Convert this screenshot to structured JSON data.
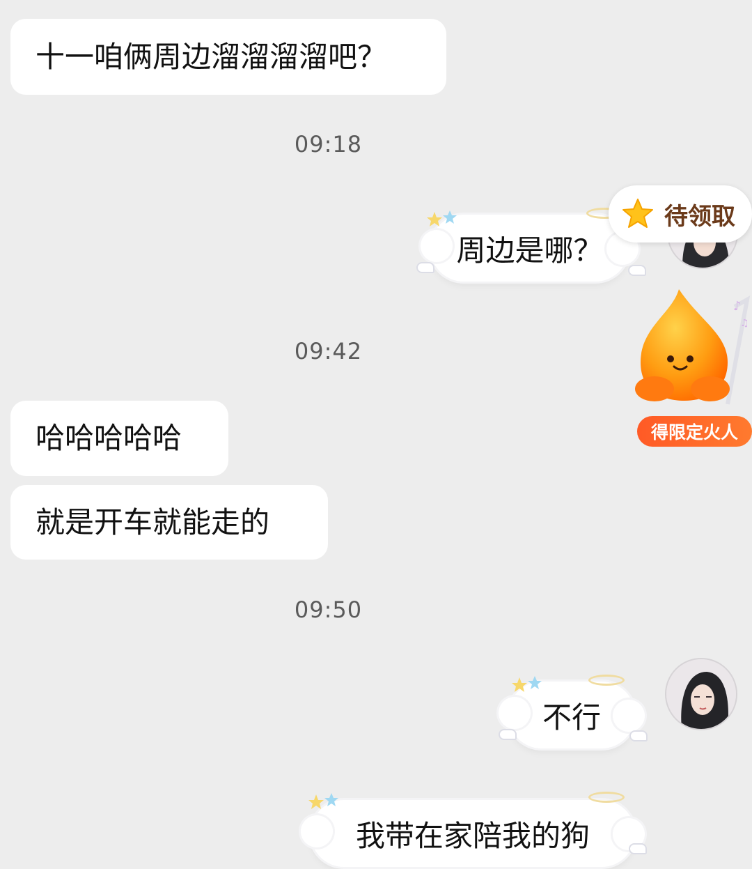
{
  "messages": {
    "m1": "十一咱俩周边溜溜溜溜吧？",
    "m2": "周边是哪？",
    "m3": "哈哈哈哈哈",
    "m4": "就是开车就能走的",
    "m5": "不行",
    "m6": "我带在家陪我的狗"
  },
  "times": {
    "t1": "09:18",
    "t2": "09:42",
    "t3": "09:50"
  },
  "widgets": {
    "pending_label": "待领取",
    "limited_label": "得限定火人"
  },
  "icons": {
    "star": "star-icon",
    "mascot": "fire-mascot-icon",
    "avatar": "avatar"
  },
  "colors": {
    "background": "#ededed",
    "bubble": "#ffffff",
    "accent_orange": "#ff5a26",
    "pending_text": "#6b3a1a"
  }
}
